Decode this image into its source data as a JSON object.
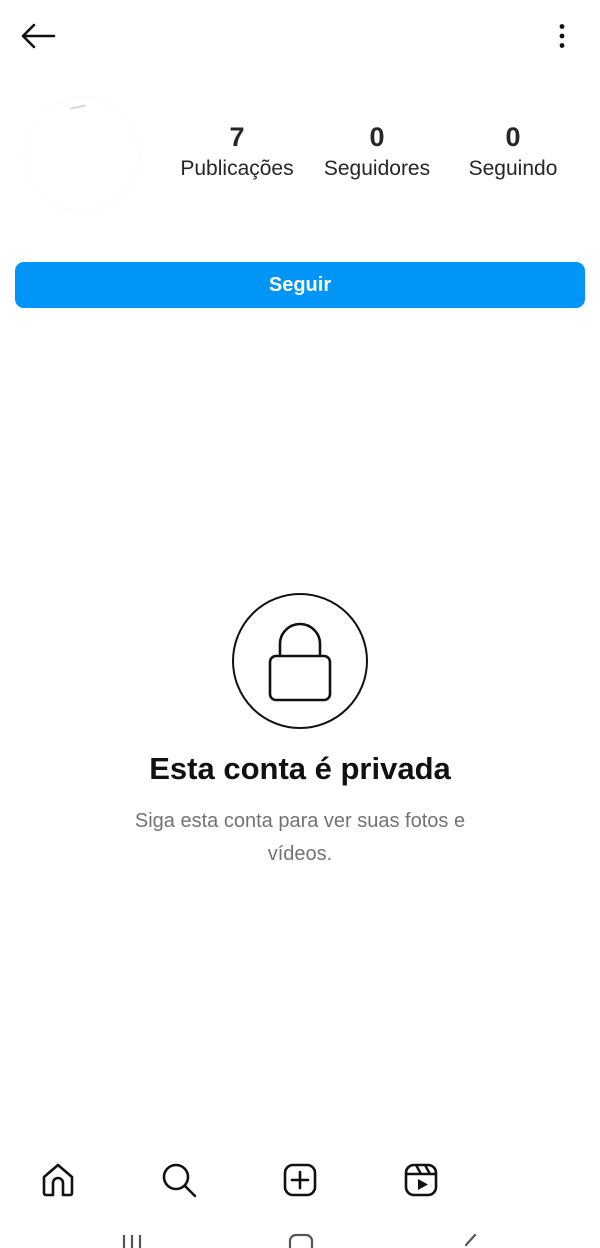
{
  "header": {
    "back_icon": "arrow-left-icon",
    "menu_icon": "more-vertical-icon"
  },
  "stats": [
    {
      "value": "7",
      "label": "Publicações"
    },
    {
      "value": "0",
      "label": "Seguidores"
    },
    {
      "value": "0",
      "label": "Seguindo"
    }
  ],
  "follow_button": {
    "label": "Seguir",
    "color": "#0095f6"
  },
  "private_notice": {
    "icon": "lock-icon",
    "title": "Esta conta é privada",
    "description": "Siga esta conta para ver suas fotos e vídeos."
  },
  "bottom_nav": {
    "items": [
      "home-icon",
      "search-icon",
      "create-icon",
      "reels-icon"
    ]
  },
  "system_nav": {
    "items": [
      "recent-apps-icon",
      "home-button-icon",
      "back-system-icon"
    ]
  }
}
